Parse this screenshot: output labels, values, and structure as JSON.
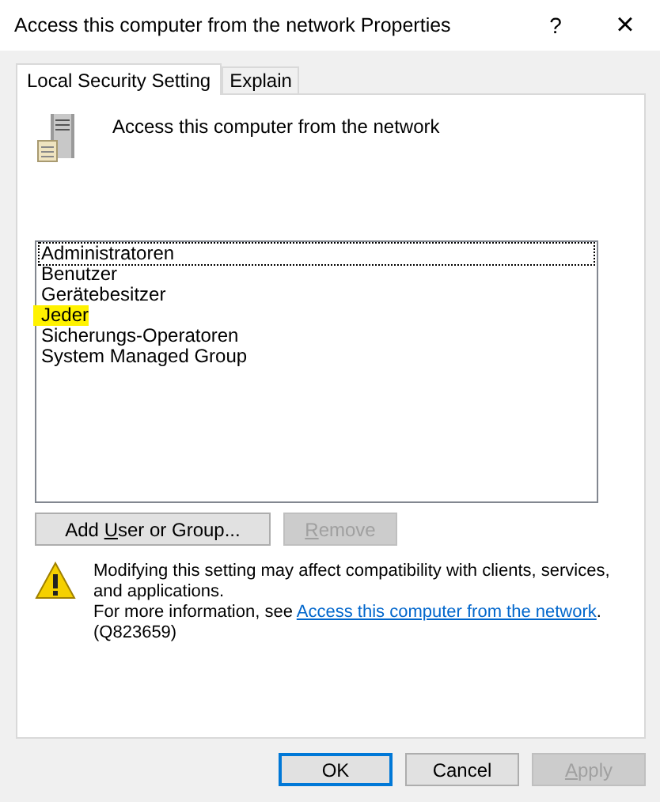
{
  "window": {
    "title": "Access this computer from the network Properties",
    "help": "?",
    "close": "×"
  },
  "tabs": [
    {
      "label": "Local Security Setting",
      "selected": true
    },
    {
      "label": "Explain",
      "selected": false
    }
  ],
  "policy": {
    "name": "Access this computer from the network"
  },
  "members": [
    {
      "name": "Administratoren",
      "focused": true,
      "highlighted": false
    },
    {
      "name": "Benutzer",
      "focused": false,
      "highlighted": false
    },
    {
      "name": "Gerätebesitzer",
      "focused": false,
      "highlighted": false
    },
    {
      "name": "Jeder",
      "focused": false,
      "highlighted": true
    },
    {
      "name": "Sicherungs-Operatoren",
      "focused": false,
      "highlighted": false
    },
    {
      "name": "System Managed Group",
      "focused": false,
      "highlighted": false
    }
  ],
  "list_buttons": [
    {
      "pre": "Add ",
      "key": "U",
      "post": "ser or Group...",
      "disabled": false
    },
    {
      "key": "R",
      "post": "emove",
      "disabled": true
    }
  ],
  "warning": {
    "text": "Modifying this setting may affect compatibility with clients, services, and applications.",
    "more": "For more information, see ",
    "link": "Access this computer from the network",
    "after": ".",
    "ref": "(Q823659)"
  },
  "dialog_buttons": [
    {
      "pre": "OK",
      "disabled": false,
      "default": true
    },
    {
      "pre": "Cancel",
      "disabled": false,
      "default": false
    },
    {
      "key": "A",
      "post": "pply",
      "disabled": true,
      "default": false
    }
  ]
}
